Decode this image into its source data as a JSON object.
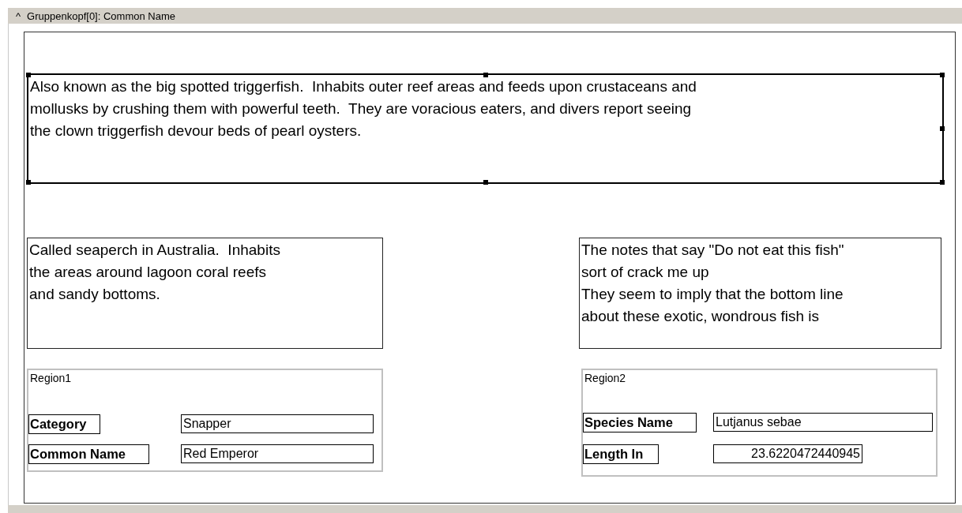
{
  "group_header": {
    "caret": "^",
    "title": "Gruppenkopf[0]: Common Name"
  },
  "text_boxes": [
    {
      "text": "Also known as the big spotted triggerfish.  Inhabits outer reef areas and feeds upon crustaceans and\nmollusks by crushing them with powerful teeth.  They are voracious eaters, and divers report seeing\nthe clown triggerfish devour beds of pearl oysters.",
      "selected": true
    },
    {
      "text": "Called seaperch in Australia.  Inhabits\nthe areas around lagoon coral reefs\nand sandy bottoms.",
      "selected": false
    },
    {
      "text": "The notes that say \"Do not eat this fish\"\nsort of crack me up\nThey seem to imply that the bottom line\nabout these exotic, wondrous fish is",
      "selected": false
    }
  ],
  "regions": [
    {
      "title": "Region1",
      "fields": [
        {
          "label": "Category",
          "value": "Snapper"
        },
        {
          "label": "Common Name",
          "value": "Red Emperor"
        }
      ]
    },
    {
      "title": "Region2",
      "fields": [
        {
          "label": "Species Name",
          "value": "Lutjanus sebae"
        },
        {
          "label": "Length In",
          "value": "23.6220472440945"
        }
      ]
    }
  ]
}
